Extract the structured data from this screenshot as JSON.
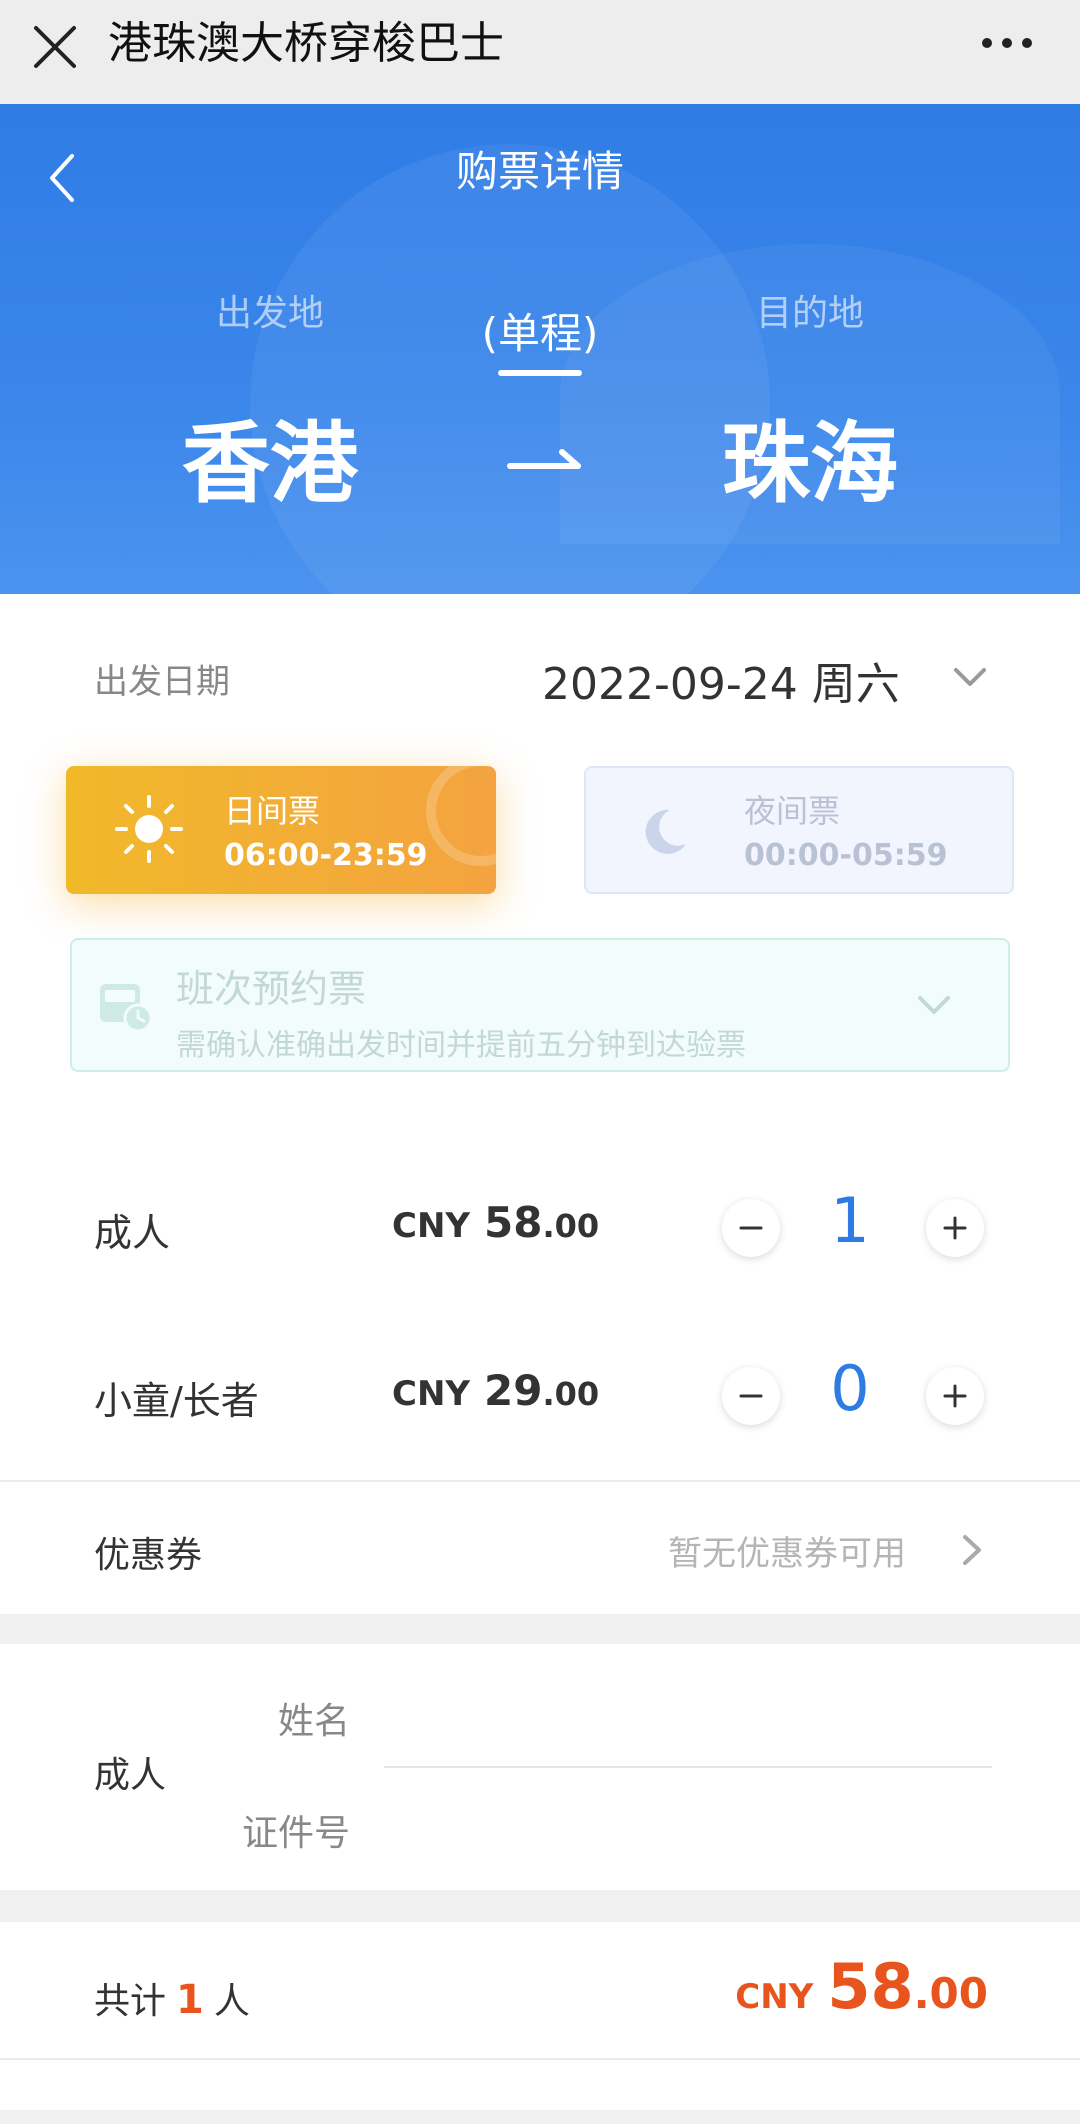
{
  "topbar": {
    "title": "港珠澳大桥穿梭巴士"
  },
  "hero": {
    "page_title": "购票详情",
    "origin_label": "出发地",
    "destination_label": "目的地",
    "trip_type": "(单程)",
    "origin": "香港",
    "destination": "珠海"
  },
  "date": {
    "label": "出发日期",
    "value": "2022-09-24 周六"
  },
  "ticket_types": {
    "day": {
      "name": "日间票",
      "time": "06:00-23:59",
      "selected": true
    },
    "night": {
      "name": "夜间票",
      "time": "00:00-05:59",
      "selected": false
    }
  },
  "reservation": {
    "name": "班次预约票",
    "desc": "需确认准确出发时间并提前五分钟到达验票"
  },
  "passengers": [
    {
      "label": "成人",
      "currency": "CNY",
      "price_int": "58",
      "price_dec": ".00",
      "count": "1"
    },
    {
      "label": "小童/长者",
      "currency": "CNY",
      "price_int": "29",
      "price_dec": ".00",
      "count": "0"
    }
  ],
  "coupon": {
    "label": "优惠券",
    "value": "暂无优惠券可用"
  },
  "passenger_info": {
    "type": "成人",
    "name_label": "姓名",
    "id_label": "证件号"
  },
  "total": {
    "prefix": "共计",
    "count": "1",
    "suffix": "人",
    "currency": "CNY",
    "amount_int": "58",
    "amount_dec": ".00"
  },
  "colors": {
    "brand_blue": "#2f7ce6",
    "day_card": "#f1b92a",
    "accent_orange": "#e8541e",
    "count_blue": "#2e7ce3"
  }
}
